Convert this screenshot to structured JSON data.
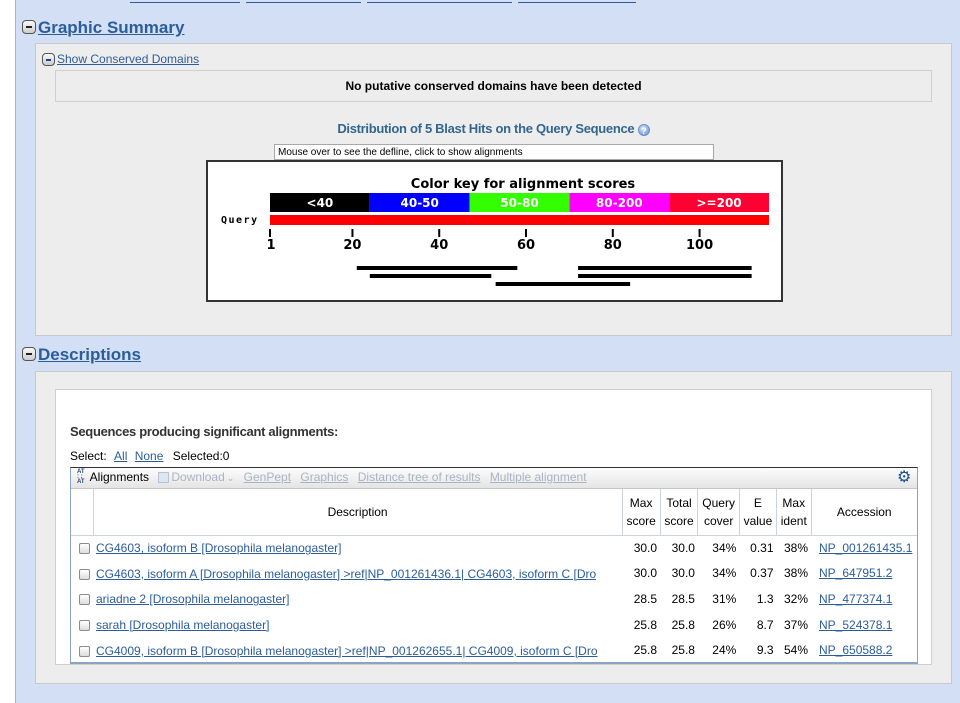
{
  "graphic_summary": {
    "heading": "Graphic Summary",
    "conserved_domains_link": "Show Conserved Domains",
    "conserved_domains_message": "No putative conserved domains have been detected",
    "distribution_title": "Distribution of 5 Blast Hits on the Query Sequence",
    "help_icon": "?",
    "defline_placeholder": "Mouse over to see the defline, click to show alignments",
    "color_key_title": "Color key for alignment scores",
    "color_key": [
      {
        "label": "<40",
        "color": "#000000"
      },
      {
        "label": "40-50",
        "color": "#0000ff"
      },
      {
        "label": "50-80",
        "color": "#33ff00"
      },
      {
        "label": "80-200",
        "color": "#ff00ff"
      },
      {
        "label": ">=200",
        "color": "#ff0033"
      }
    ],
    "query_label": "Query",
    "query_color": "#ff0000",
    "query_length": 116,
    "ticks": [
      1,
      20,
      40,
      60,
      80,
      100
    ],
    "hits": [
      {
        "row": 0,
        "segments": [
          [
            21,
            58
          ],
          [
            72,
            112
          ]
        ],
        "color": "#000000"
      },
      {
        "row": 1,
        "segments": [
          [
            24,
            52
          ],
          [
            72,
            112
          ]
        ],
        "color": "#000000"
      },
      {
        "row": 2,
        "segments": [
          [
            53,
            84
          ]
        ],
        "color": "#000000"
      }
    ]
  },
  "descriptions": {
    "heading": "Descriptions",
    "title": "Sequences producing significant alignments:",
    "select_label": "Select:",
    "select_all": "All",
    "select_none": "None",
    "selected_count": "Selected:0",
    "toolbar": {
      "alignments": "Alignments",
      "download": "Download",
      "genpept": "GenPept",
      "graphics": "Graphics",
      "distance_tree": "Distance tree of results",
      "multiple_alignment": "Multiple alignment"
    },
    "columns": {
      "description": "Description",
      "max_score": [
        "Max",
        "score"
      ],
      "total_score": [
        "Total",
        "score"
      ],
      "query_cover": [
        "Query",
        "cover"
      ],
      "e_value": [
        "E",
        "value"
      ],
      "max_ident": [
        "Max",
        "ident"
      ],
      "accession": "Accession"
    },
    "rows": [
      {
        "description": "CG4603, isoform B [Drosophila melanogaster]",
        "max_score": "30.0",
        "total_score": "30.0",
        "query_cover": "34%",
        "e_value": "0.31",
        "max_ident": "38%",
        "accession": "NP_001261435.1"
      },
      {
        "description": "CG4603, isoform A [Drosophila melanogaster] >ref|NP_001261436.1| CG4603, isoform C [Dro",
        "max_score": "30.0",
        "total_score": "30.0",
        "query_cover": "34%",
        "e_value": "0.37",
        "max_ident": "38%",
        "accession": "NP_647951.2"
      },
      {
        "description": "ariadne 2 [Drosophila melanogaster]",
        "max_score": "28.5",
        "total_score": "28.5",
        "query_cover": "31%",
        "e_value": "1.3",
        "max_ident": "32%",
        "accession": "NP_477374.1"
      },
      {
        "description": "sarah [Drosophila melanogaster]",
        "max_score": "25.8",
        "total_score": "25.8",
        "query_cover": "26%",
        "e_value": "8.7",
        "max_ident": "37%",
        "accession": "NP_524378.1"
      },
      {
        "description": "CG4009, isoform B [Drosophila melanogaster] >ref|NP_001262655.1| CG4009, isoform C [Dro",
        "max_score": "25.8",
        "total_score": "25.8",
        "query_cover": "24%",
        "e_value": "9.3",
        "max_ident": "54%",
        "accession": "NP_650588.2"
      }
    ]
  }
}
